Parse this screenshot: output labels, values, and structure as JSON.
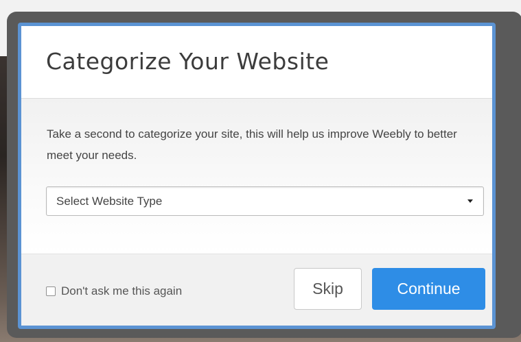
{
  "modal": {
    "title": "Categorize Your Website",
    "description": "Take a second to categorize your site, this will help us improve Weebly to better meet your needs.",
    "select": {
      "value": "Select Website Type"
    },
    "footer": {
      "checkbox_label": "Don't ask me this again",
      "checkbox_checked": false,
      "skip_label": "Skip",
      "continue_label": "Continue"
    }
  },
  "colors": {
    "accent": "#2e8de6",
    "modal_border": "#5b93d3",
    "title_text": "#3c3c3c",
    "body_text": "#444444"
  },
  "icons": {
    "dropdown": "caret-down-icon"
  }
}
